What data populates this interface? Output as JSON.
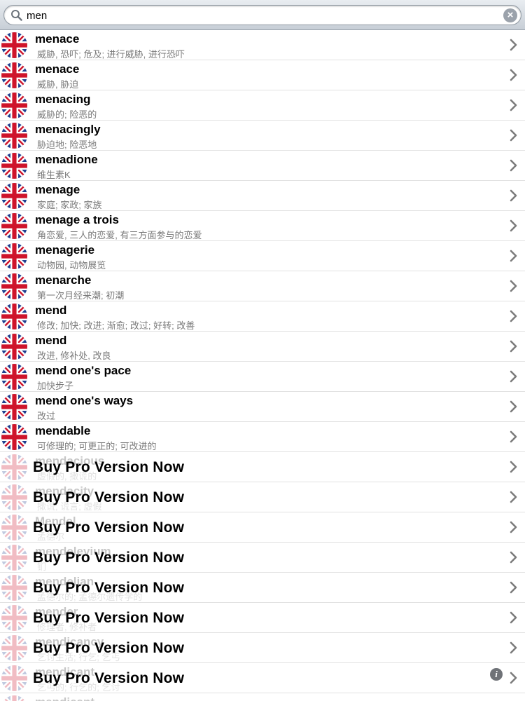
{
  "search": {
    "value": "men",
    "placeholder": ""
  },
  "rows": [
    {
      "word": "menace",
      "meaning": "威胁, 恐吓; 危及; 进行威胁, 进行恐吓"
    },
    {
      "word": "menace",
      "meaning": "威胁, 胁迫"
    },
    {
      "word": "menacing",
      "meaning": "威胁的; 险恶的"
    },
    {
      "word": "menacingly",
      "meaning": "胁迫地; 险恶地"
    },
    {
      "word": "menadione",
      "meaning": "维生素K"
    },
    {
      "word": "menage",
      "meaning": "家庭; 家政; 家族"
    },
    {
      "word": "menage a trois",
      "meaning": "角恋爱, 三人的恋爱, 有三方面参与的恋爱"
    },
    {
      "word": "menagerie",
      "meaning": "动物园, 动物展览"
    },
    {
      "word": "menarche",
      "meaning": "第一次月经来潮; 初潮"
    },
    {
      "word": "mend",
      "meaning": "修改; 加快; 改进; 渐愈; 改过; 好转; 改善"
    },
    {
      "word": "mend",
      "meaning": "改进, 修补处, 改良"
    },
    {
      "word": "mend one's pace",
      "meaning": "加快步子"
    },
    {
      "word": "mend one's ways",
      "meaning": "改过"
    },
    {
      "word": "mendable",
      "meaning": "可修理的; 可更正的; 可改进的"
    }
  ],
  "locked_rows": [
    {
      "word": "mendacious",
      "meaning": "虚假的, 撒谎的",
      "promo": "Buy Pro Version Now"
    },
    {
      "word": "mendacity",
      "meaning": "撒谎; 谎言; 虚假",
      "promo": "Buy Pro Version Now"
    },
    {
      "word": "Mendel",
      "meaning": "孟德尔",
      "promo": "Buy Pro Version Now"
    },
    {
      "word": "mendelevium",
      "meaning": "钔",
      "promo": "Buy Pro Version Now"
    },
    {
      "word": "mendelian",
      "meaning": "孟德尔的; 孟德尔遗传学的",
      "promo": "Buy Pro Version Now"
    },
    {
      "word": "mender",
      "meaning": "修理者, 修补者",
      "promo": "Buy Pro Version Now"
    },
    {
      "word": "mendicancy",
      "meaning": "乞讨生活; 行乞; 乞丐",
      "promo": "Buy Pro Version Now"
    },
    {
      "word": "mendicant",
      "meaning": "乞丐的; 行乞的; 乞讨",
      "promo": "Buy Pro Version Now"
    },
    {
      "word": "mendicant",
      "meaning": "",
      "promo": ""
    }
  ],
  "colors": {
    "flag_blue": "#1f3f8f",
    "flag_red": "#cf142b",
    "chevron": "#7c7c7c",
    "meaning_text": "#7a7a7a"
  },
  "icons": {
    "search": "magnifier-icon",
    "clear": "clear-x-icon",
    "flag": "uk-flag-icon",
    "chevron": "chevron-right-icon",
    "info": "info-icon"
  }
}
